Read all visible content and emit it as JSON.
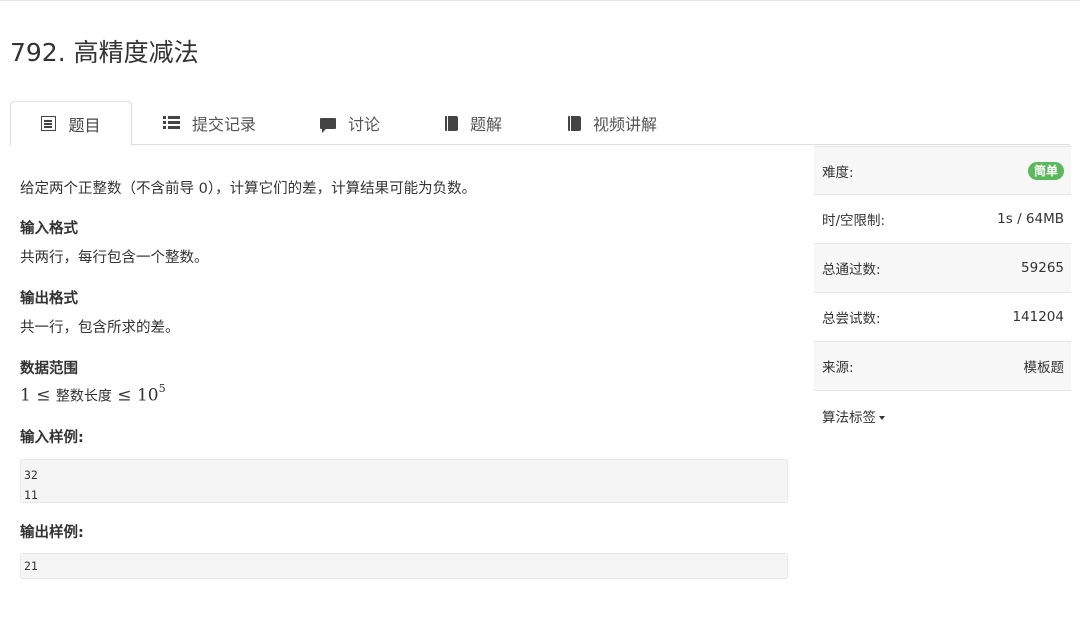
{
  "problem": {
    "title": "792. 高精度减法"
  },
  "tabs": [
    {
      "label": "题目",
      "icon": "list-box-icon",
      "active": true
    },
    {
      "label": "提交记录",
      "icon": "list-lines-icon"
    },
    {
      "label": "讨论",
      "icon": "comment-icon"
    },
    {
      "label": "题解",
      "icon": "book-icon"
    },
    {
      "label": "视频讲解",
      "icon": "book-icon"
    }
  ],
  "content": {
    "description": "给定两个正整数（不含前导 0），计算它们的差，计算结果可能为负数。",
    "input_format_heading": "输入格式",
    "input_format": "共两行，每行包含一个整数。",
    "output_format_heading": "输出格式",
    "output_format": "共一行，包含所求的差。",
    "range_heading": "数据范围",
    "range": {
      "low": "1",
      "le": "≤",
      "text": "整数长度",
      "base": "10",
      "exp": "5"
    },
    "sample_input_heading": "输入样例:",
    "sample_input": [
      "32",
      "11"
    ],
    "sample_output_heading": "输出样例:",
    "sample_output": [
      "21"
    ]
  },
  "side": {
    "difficulty_label": "难度:",
    "difficulty_value": "简单",
    "limit_label": "时/空限制:",
    "limit_value": "1s / 64MB",
    "passed_label": "总通过数:",
    "passed_value": "59265",
    "attempts_label": "总尝试数:",
    "attempts_value": "141204",
    "source_label": "来源:",
    "source_value": "模板题",
    "tags_label": "算法标签"
  },
  "colors": {
    "badge_green": "#5cb85c",
    "panel_shade": "#f7f7f7"
  }
}
